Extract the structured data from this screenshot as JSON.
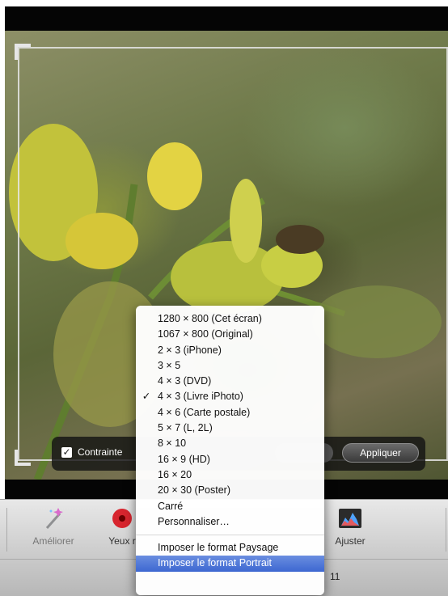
{
  "crop_hud": {
    "constrain_label": "Contrainte",
    "checkbox_mark": "✓",
    "apply_label": "Appliquer"
  },
  "format_menu": {
    "check_mark": "✓",
    "items": [
      "1280 × 800  (Cet écran)",
      "1067 × 800  (Original)",
      "2 × 3  (iPhone)",
      "3 × 5",
      "4 × 3  (DVD)",
      "4 × 3  (Livre iPhoto)",
      "4 × 6  (Carte postale)",
      "5 × 7  (L, 2L)",
      "8 × 10",
      "16 × 9  (HD)",
      "16 × 20",
      "20 × 30  (Poster)",
      "Carré",
      "Personnaliser…"
    ],
    "checked_item": "4 × 3  (Livre iPhoto)",
    "orientation_items": [
      "Imposer le format Paysage",
      "Imposer le format Portrait"
    ],
    "highlighted_item": "Imposer le format Portrait"
  },
  "toolbar": {
    "enhance_label": "Améliorer",
    "red_eye_label": "Yeux r",
    "adjust_label": "Ajuster",
    "icons": [
      "magic-wand-icon",
      "red-eye-icon",
      "adjust-histogram-icon"
    ]
  },
  "status_bar": {
    "text": "11"
  }
}
